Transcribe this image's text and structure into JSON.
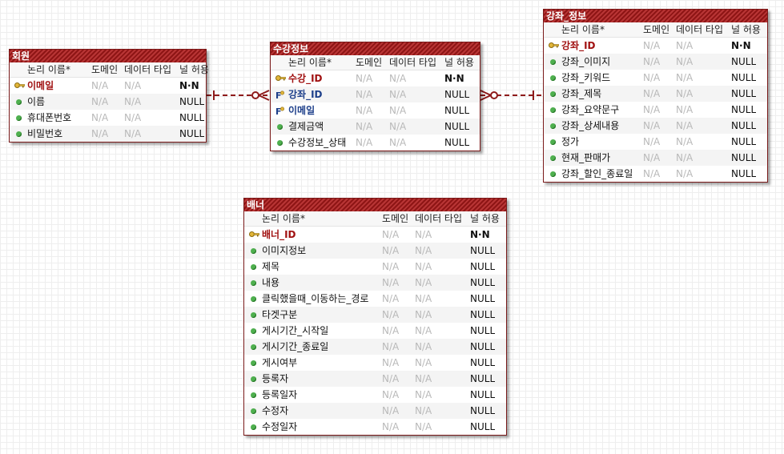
{
  "header_labels": {
    "name": "논리 이름*",
    "domain": "도메인",
    "dtype": "데이터 타입",
    "nullable": "널 허용"
  },
  "icons": {
    "primary_key": "key-icon",
    "foreign_key": "foreign-key-icon",
    "attribute": "attribute-dot-icon"
  },
  "colors": {
    "title_bar": "#8e1515",
    "pk_text": "#a01010",
    "fk_text": "#1d3f8a",
    "attr_dot": "#4fb04f",
    "relationship_line": "#8e1b1b"
  },
  "entities": [
    {
      "id": "member",
      "title": "회원",
      "rows": [
        {
          "kind": "pk",
          "name": "이메일",
          "domain": "N/A",
          "dtype": "N/A",
          "nullable": "N·N"
        },
        {
          "kind": "attr",
          "name": "이름",
          "domain": "N/A",
          "dtype": "N/A",
          "nullable": "NULL"
        },
        {
          "kind": "attr",
          "name": "휴대폰번호",
          "domain": "N/A",
          "dtype": "N/A",
          "nullable": "NULL"
        },
        {
          "kind": "attr",
          "name": "비밀번호",
          "domain": "N/A",
          "dtype": "N/A",
          "nullable": "NULL"
        }
      ]
    },
    {
      "id": "enrollment",
      "title": "수강정보",
      "rows": [
        {
          "kind": "pk",
          "name": "수강_ID",
          "domain": "N/A",
          "dtype": "N/A",
          "nullable": "N·N"
        },
        {
          "kind": "fk",
          "name": "강좌_ID",
          "domain": "N/A",
          "dtype": "N/A",
          "nullable": "NULL"
        },
        {
          "kind": "fk",
          "name": "이메일",
          "domain": "N/A",
          "dtype": "N/A",
          "nullable": "NULL"
        },
        {
          "kind": "attr",
          "name": "결제금액",
          "domain": "N/A",
          "dtype": "N/A",
          "nullable": "NULL"
        },
        {
          "kind": "attr",
          "name": "수강정보_상태",
          "domain": "N/A",
          "dtype": "N/A",
          "nullable": "NULL"
        }
      ]
    },
    {
      "id": "course",
      "title": "강좌_정보",
      "rows": [
        {
          "kind": "pk",
          "name": "강좌_ID",
          "domain": "N/A",
          "dtype": "N/A",
          "nullable": "N·N"
        },
        {
          "kind": "attr",
          "name": "강좌_이미지",
          "domain": "N/A",
          "dtype": "N/A",
          "nullable": "NULL"
        },
        {
          "kind": "attr",
          "name": "강좌_키워드",
          "domain": "N/A",
          "dtype": "N/A",
          "nullable": "NULL"
        },
        {
          "kind": "attr",
          "name": "강좌_제목",
          "domain": "N/A",
          "dtype": "N/A",
          "nullable": "NULL"
        },
        {
          "kind": "attr",
          "name": "강좌_요약문구",
          "domain": "N/A",
          "dtype": "N/A",
          "nullable": "NULL"
        },
        {
          "kind": "attr",
          "name": "강좌_상세내용",
          "domain": "N/A",
          "dtype": "N/A",
          "nullable": "NULL"
        },
        {
          "kind": "attr",
          "name": "정가",
          "domain": "N/A",
          "dtype": "N/A",
          "nullable": "NULL"
        },
        {
          "kind": "attr",
          "name": "현재_판매가",
          "domain": "N/A",
          "dtype": "N/A",
          "nullable": "NULL"
        },
        {
          "kind": "attr",
          "name": "강좌_할인_종료일",
          "domain": "N/A",
          "dtype": "N/A",
          "nullable": "NULL"
        }
      ]
    },
    {
      "id": "banner",
      "title": "배너",
      "rows": [
        {
          "kind": "pk",
          "name": "배너_ID",
          "domain": "N/A",
          "dtype": "N/A",
          "nullable": "N·N"
        },
        {
          "kind": "attr",
          "name": "이미지정보",
          "domain": "N/A",
          "dtype": "N/A",
          "nullable": "NULL"
        },
        {
          "kind": "attr",
          "name": "제목",
          "domain": "N/A",
          "dtype": "N/A",
          "nullable": "NULL"
        },
        {
          "kind": "attr",
          "name": "내용",
          "domain": "N/A",
          "dtype": "N/A",
          "nullable": "NULL"
        },
        {
          "kind": "attr",
          "name": "클릭했을때_이동하는_경로",
          "domain": "N/A",
          "dtype": "N/A",
          "nullable": "NULL"
        },
        {
          "kind": "attr",
          "name": "타겟구분",
          "domain": "N/A",
          "dtype": "N/A",
          "nullable": "NULL"
        },
        {
          "kind": "attr",
          "name": "게시기간_시작일",
          "domain": "N/A",
          "dtype": "N/A",
          "nullable": "NULL"
        },
        {
          "kind": "attr",
          "name": "게시기간_종료일",
          "domain": "N/A",
          "dtype": "N/A",
          "nullable": "NULL"
        },
        {
          "kind": "attr",
          "name": "게시여부",
          "domain": "N/A",
          "dtype": "N/A",
          "nullable": "NULL"
        },
        {
          "kind": "attr",
          "name": "등록자",
          "domain": "N/A",
          "dtype": "N/A",
          "nullable": "NULL"
        },
        {
          "kind": "attr",
          "name": "등록일자",
          "domain": "N/A",
          "dtype": "N/A",
          "nullable": "NULL"
        },
        {
          "kind": "attr",
          "name": "수정자",
          "domain": "N/A",
          "dtype": "N/A",
          "nullable": "NULL"
        },
        {
          "kind": "attr",
          "name": "수정일자",
          "domain": "N/A",
          "dtype": "N/A",
          "nullable": "NULL"
        }
      ]
    }
  ],
  "relationships": [
    {
      "from": "member",
      "to": "enrollment",
      "parent_end": "one",
      "child_end": "zero-or-many",
      "style": "dashed"
    },
    {
      "from": "course",
      "to": "enrollment",
      "parent_end": "one",
      "child_end": "zero-or-many",
      "style": "dashed"
    }
  ]
}
